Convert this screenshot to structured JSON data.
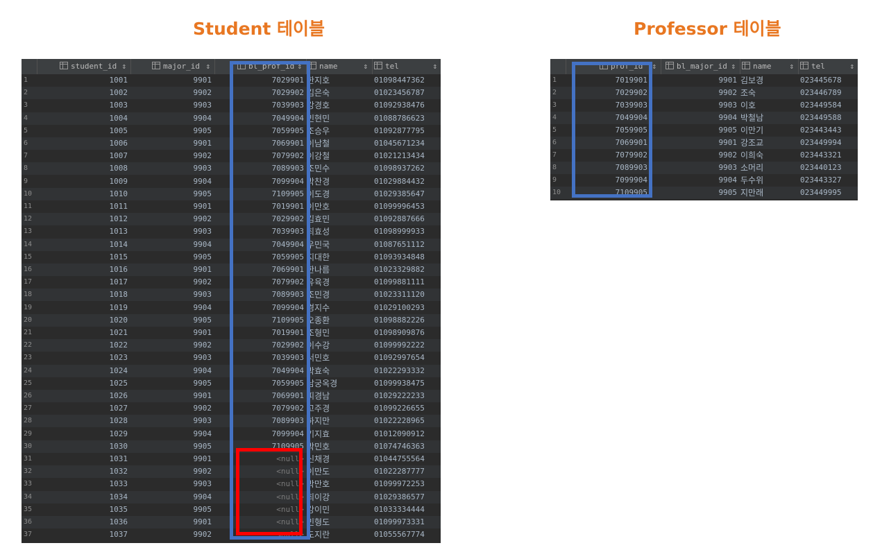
{
  "titles": {
    "student": "Student 테이블",
    "professor": "Professor 테이블"
  },
  "student_table": {
    "columns": {
      "student_id": "student_id",
      "major_id": "major_id",
      "prof_id": "bl_prof_id",
      "name": "name",
      "tel": "tel"
    },
    "sort_symbol": "⇕",
    "rows": [
      {
        "n": "1",
        "student_id": "1001",
        "major_id": "9901",
        "prof_id": "7029901",
        "name": "한지호",
        "tel": "01098447362"
      },
      {
        "n": "2",
        "student_id": "1002",
        "major_id": "9902",
        "prof_id": "7029902",
        "name": "김은숙",
        "tel": "01023456787"
      },
      {
        "n": "3",
        "student_id": "1003",
        "major_id": "9903",
        "prof_id": "7039903",
        "name": "강경호",
        "tel": "01092938476"
      },
      {
        "n": "4",
        "student_id": "1004",
        "major_id": "9904",
        "prof_id": "7049904",
        "name": "민현민",
        "tel": "01088786623"
      },
      {
        "n": "5",
        "student_id": "1005",
        "major_id": "9905",
        "prof_id": "7059905",
        "name": "조승우",
        "tel": "01092877795"
      },
      {
        "n": "6",
        "student_id": "1006",
        "major_id": "9901",
        "prof_id": "7069901",
        "name": "이남철",
        "tel": "01045671234"
      },
      {
        "n": "7",
        "student_id": "1007",
        "major_id": "9902",
        "prof_id": "7079902",
        "name": "이강철",
        "tel": "01021213434"
      },
      {
        "n": "8",
        "student_id": "1008",
        "major_id": "9903",
        "prof_id": "7089903",
        "name": "조민수",
        "tel": "01098937262"
      },
      {
        "n": "9",
        "student_id": "1009",
        "major_id": "9904",
        "prof_id": "7099904",
        "name": "박찬경",
        "tel": "01029884432"
      },
      {
        "n": "10",
        "student_id": "1010",
        "major_id": "9905",
        "prof_id": "7109905",
        "name": "이도경",
        "tel": "01029385647"
      },
      {
        "n": "11",
        "student_id": "1011",
        "major_id": "9901",
        "prof_id": "7019901",
        "name": "이만호",
        "tel": "01099996453"
      },
      {
        "n": "12",
        "student_id": "1012",
        "major_id": "9902",
        "prof_id": "7029902",
        "name": "김효민",
        "tel": "01092887666"
      },
      {
        "n": "13",
        "student_id": "1013",
        "major_id": "9903",
        "prof_id": "7039903",
        "name": "최효성",
        "tel": "01098999933"
      },
      {
        "n": "14",
        "student_id": "1014",
        "major_id": "9904",
        "prof_id": "7049904",
        "name": "우민국",
        "tel": "01087651112"
      },
      {
        "n": "15",
        "student_id": "1015",
        "major_id": "9905",
        "prof_id": "7059905",
        "name": "지대한",
        "tel": "01093934848"
      },
      {
        "n": "16",
        "student_id": "1016",
        "major_id": "9901",
        "prof_id": "7069901",
        "name": "한나름",
        "tel": "01023329882"
      },
      {
        "n": "17",
        "student_id": "1017",
        "major_id": "9902",
        "prof_id": "7079902",
        "name": "유육경",
        "tel": "01099881111"
      },
      {
        "n": "18",
        "student_id": "1018",
        "major_id": "9903",
        "prof_id": "7089903",
        "name": "조민경",
        "tel": "01023311120"
      },
      {
        "n": "19",
        "student_id": "1019",
        "major_id": "9904",
        "prof_id": "7099904",
        "name": "경지수",
        "tel": "01029100293"
      },
      {
        "n": "20",
        "student_id": "1020",
        "major_id": "9905",
        "prof_id": "7109905",
        "name": "오종환",
        "tel": "01098882226"
      },
      {
        "n": "21",
        "student_id": "1021",
        "major_id": "9901",
        "prof_id": "7019901",
        "name": "조형민",
        "tel": "01098909876"
      },
      {
        "n": "22",
        "student_id": "1022",
        "major_id": "9902",
        "prof_id": "7029902",
        "name": "이수강",
        "tel": "01099992222"
      },
      {
        "n": "23",
        "student_id": "1023",
        "major_id": "9903",
        "prof_id": "7039903",
        "name": "서민호",
        "tel": "01092997654"
      },
      {
        "n": "24",
        "student_id": "1024",
        "major_id": "9904",
        "prof_id": "7049904",
        "name": "박효숙",
        "tel": "01022293332"
      },
      {
        "n": "25",
        "student_id": "1025",
        "major_id": "9905",
        "prof_id": "7059905",
        "name": "남궁옥경",
        "tel": "01099938475"
      },
      {
        "n": "26",
        "student_id": "1026",
        "major_id": "9901",
        "prof_id": "7069901",
        "name": "피경남",
        "tel": "01029222233"
      },
      {
        "n": "27",
        "student_id": "1027",
        "major_id": "9902",
        "prof_id": "7079902",
        "name": "고주경",
        "tel": "01099226655"
      },
      {
        "n": "28",
        "student_id": "1028",
        "major_id": "9903",
        "prof_id": "7089903",
        "name": "하지만",
        "tel": "01022228965"
      },
      {
        "n": "29",
        "student_id": "1029",
        "major_id": "9904",
        "prof_id": "7099904",
        "name": "기지효",
        "tel": "01012090912"
      },
      {
        "n": "30",
        "student_id": "1030",
        "major_id": "9905",
        "prof_id": "7109905",
        "name": "박민호",
        "tel": "01074746363"
      },
      {
        "n": "31",
        "student_id": "1031",
        "major_id": "9901",
        "prof_id": "<null>",
        "name": "신채경",
        "tel": "01044755564"
      },
      {
        "n": "32",
        "student_id": "1032",
        "major_id": "9902",
        "prof_id": "<null>",
        "name": "이만도",
        "tel": "01022287777"
      },
      {
        "n": "33",
        "student_id": "1033",
        "major_id": "9903",
        "prof_id": "<null>",
        "name": "박만호",
        "tel": "01099972253"
      },
      {
        "n": "34",
        "student_id": "1034",
        "major_id": "9904",
        "prof_id": "<null>",
        "name": "최이강",
        "tel": "01029386577"
      },
      {
        "n": "35",
        "student_id": "1035",
        "major_id": "9905",
        "prof_id": "<null>",
        "name": "강이민",
        "tel": "01033334444"
      },
      {
        "n": "36",
        "student_id": "1036",
        "major_id": "9901",
        "prof_id": "<null>",
        "name": "민형도",
        "tel": "01099973331"
      },
      {
        "n": "37",
        "student_id": "1037",
        "major_id": "9902",
        "prof_id": "<null>",
        "name": "도지란",
        "tel": "01055567774"
      }
    ]
  },
  "professor_table": {
    "columns": {
      "prof_id": "prof_id",
      "bl_major_id": "bl_major_id",
      "name": "name",
      "tel": "tel"
    },
    "sort_symbol": "⇕",
    "rows": [
      {
        "n": "1",
        "prof_id": "7019901",
        "bl_major_id": "9901",
        "name": "김보경",
        "tel": "023445678"
      },
      {
        "n": "2",
        "prof_id": "7029902",
        "bl_major_id": "9902",
        "name": "조숙",
        "tel": "023446789"
      },
      {
        "n": "3",
        "prof_id": "7039903",
        "bl_major_id": "9903",
        "name": "이호",
        "tel": "023449584"
      },
      {
        "n": "4",
        "prof_id": "7049904",
        "bl_major_id": "9904",
        "name": "박철남",
        "tel": "023449588"
      },
      {
        "n": "5",
        "prof_id": "7059905",
        "bl_major_id": "9905",
        "name": "이만기",
        "tel": "023443443"
      },
      {
        "n": "6",
        "prof_id": "7069901",
        "bl_major_id": "9901",
        "name": "강조교",
        "tel": "023449994"
      },
      {
        "n": "7",
        "prof_id": "7079902",
        "bl_major_id": "9902",
        "name": "이희숙",
        "tel": "023443321"
      },
      {
        "n": "8",
        "prof_id": "7089903",
        "bl_major_id": "9903",
        "name": "소머리",
        "tel": "023440123"
      },
      {
        "n": "9",
        "prof_id": "7099904",
        "bl_major_id": "9904",
        "name": "두수위",
        "tel": "023443327"
      },
      {
        "n": "10",
        "prof_id": "7109905",
        "bl_major_id": "9905",
        "name": "지만래",
        "tel": "023449995"
      }
    ]
  },
  "colors": {
    "highlight_blue": "#4472c4",
    "highlight_red": "#ff0000",
    "title_orange": "#e87722"
  }
}
